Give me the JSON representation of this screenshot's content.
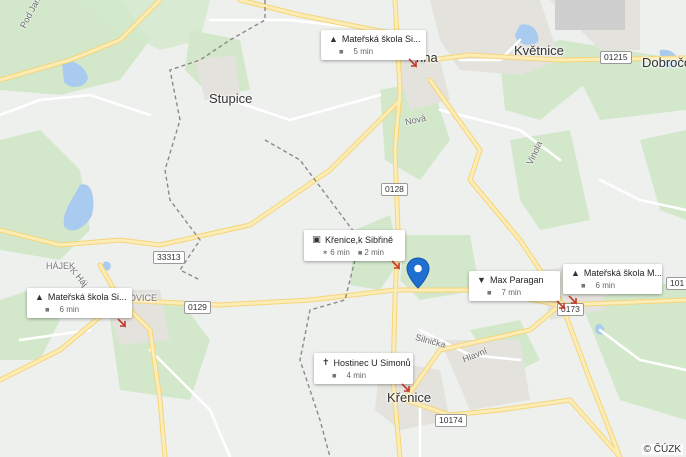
{
  "towns": {
    "stupice": "Stupice",
    "kvetnice": "Květnice",
    "dobrocho": "Dobročo",
    "sibrina": "rina",
    "krenice": "Křenice",
    "hajek": "HÁJEK",
    "alovice": "ÁLOVICE"
  },
  "streets": {
    "pod_jankovkou": "Pod Jankovkou",
    "nova": "Nová",
    "vinola": "Vinola",
    "silnicka": "Silnička",
    "hlavni": "Hlavní",
    "k_hajku": "K Háj"
  },
  "roads": [
    "01215",
    "0128",
    "33313",
    "0129",
    "10174",
    "0173",
    "101"
  ],
  "cards": [
    {
      "id": "ms-sibrina",
      "icon": "graduation-cap-icon",
      "title": "Mateřská škola Si...",
      "modes": [
        {
          "icon": "car-icon",
          "time": "5 min"
        }
      ]
    },
    {
      "id": "bus-krenice",
      "icon": "bus-icon",
      "title": "Křenice,k Sibřině",
      "modes": [
        {
          "icon": "walk-icon",
          "time": "6 min"
        },
        {
          "icon": "car-icon",
          "time": "2 min"
        }
      ]
    },
    {
      "id": "ms-left",
      "icon": "graduation-cap-icon",
      "title": "Mateřská škola Si...",
      "modes": [
        {
          "icon": "car-icon",
          "time": "6 min"
        }
      ]
    },
    {
      "id": "max-paragan",
      "icon": "cart-icon",
      "title": "Max Paragan",
      "modes": [
        {
          "icon": "car-icon",
          "time": "7 min"
        }
      ]
    },
    {
      "id": "ms-right",
      "icon": "graduation-cap-icon",
      "title": "Mateřská škola M...",
      "modes": [
        {
          "icon": "car-icon",
          "time": "6 min"
        }
      ]
    },
    {
      "id": "hostinec",
      "icon": "restaurant-icon",
      "title": "Hostinec U Simonů",
      "modes": [
        {
          "icon": "car-icon",
          "time": "4 min"
        }
      ]
    }
  ],
  "copyright": "© ČÚZK",
  "colors": {
    "water": "#a8cbef",
    "forest": "#cfe5c6",
    "road": "#fbe6a3",
    "pin": "#1f6fd1"
  }
}
